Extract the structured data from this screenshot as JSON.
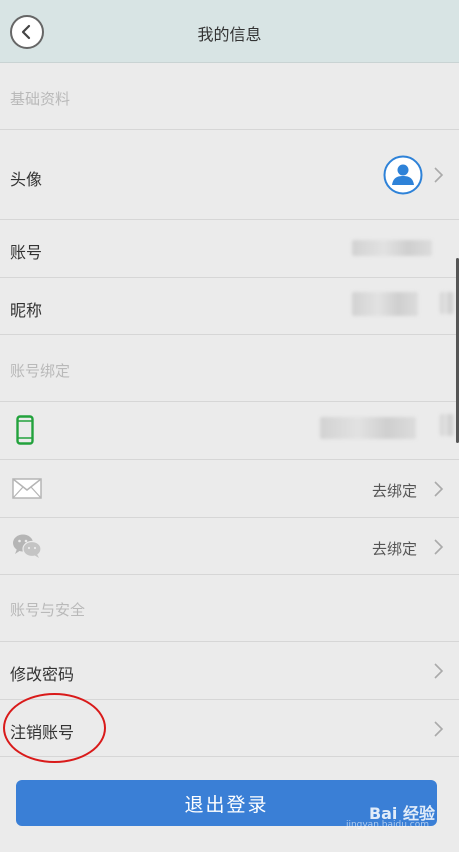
{
  "header": {
    "title": "我的信息"
  },
  "sections": {
    "basic": "基础资料",
    "binding": "账号绑定",
    "security": "账号与安全"
  },
  "rows": {
    "avatar": "头像",
    "account": "账号",
    "nickname": "昵称",
    "email_action": "去绑定",
    "wechat_action": "去绑定",
    "change_password": "修改密码",
    "cancel_account": "注销账号"
  },
  "logout_label": "退出登录",
  "watermark": {
    "brand": "Bai 经验",
    "site": "jingyan.baidu.com"
  },
  "colors": {
    "accent": "#3a7fd6",
    "header_bg": "#d8e4e4",
    "phone_icon": "#22a23c",
    "annotation": "#d91a1a"
  },
  "icons": [
    "back-icon",
    "user-avatar-icon",
    "phone-icon",
    "mail-icon",
    "wechat-icon",
    "chevron-right-icon"
  ]
}
